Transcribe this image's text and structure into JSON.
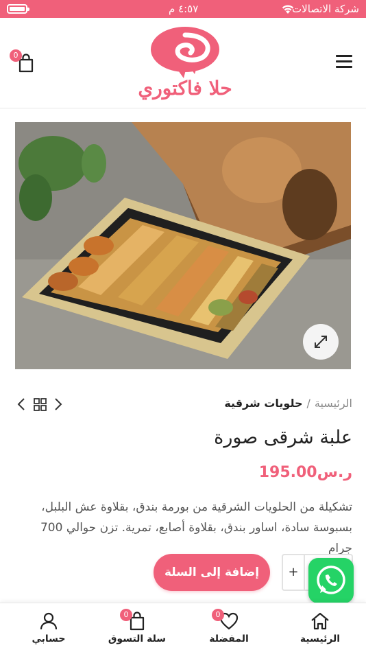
{
  "status_bar": {
    "carrier": "شركة الاتصالات",
    "time": "٤:٥٧ م"
  },
  "header": {
    "logo_text": "حلا فاكتوري",
    "cart_count": "0",
    "brand_color": "#f0607a"
  },
  "product": {
    "breadcrumb_home": "الرئيسية",
    "breadcrumb_sep": "/",
    "breadcrumb_category": "حلويات شرقية",
    "title": "علبة شرقى صورة",
    "price": "ر.س195.00",
    "description": "تشكيلة من الحلويات الشرقية من بورمة بندق، بقلاوة عش البلبل، بسبوسة سادة، اساور بندق، بقلاوة أصابع، تمرية. تزن حوالي 700 جرام",
    "quantity_plus": "+",
    "add_to_cart": "إضافة إلى السلة"
  },
  "bottom_nav": {
    "items": [
      {
        "label": "الرئيسية",
        "icon": "home-icon"
      },
      {
        "label": "المفضلة",
        "icon": "heart-icon",
        "badge": "0"
      },
      {
        "label": "سلة التسوق",
        "icon": "shopping-bag-icon",
        "badge": "0"
      },
      {
        "label": "حسابي",
        "icon": "user-icon"
      }
    ]
  }
}
